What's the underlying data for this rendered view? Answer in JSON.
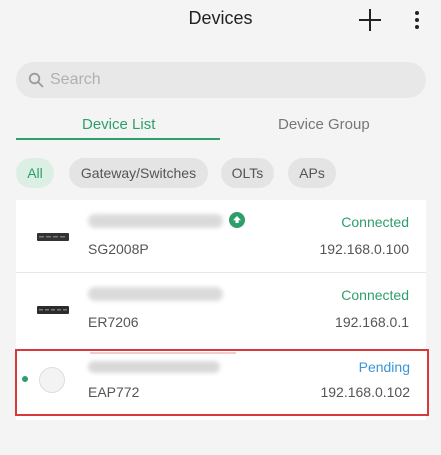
{
  "header": {
    "title": "Devices"
  },
  "search": {
    "placeholder": "Search"
  },
  "tabs": [
    {
      "label": "Device List",
      "active": true
    },
    {
      "label": "Device Group",
      "active": false
    }
  ],
  "filters": [
    {
      "label": "All",
      "active": true
    },
    {
      "label": "Gateway/Switches",
      "active": false
    },
    {
      "label": "OLTs",
      "active": false
    },
    {
      "label": "APs",
      "active": false
    }
  ],
  "devices": [
    {
      "model": "SG2008P",
      "status": "Connected",
      "ip": "192.168.0.100",
      "status_color": "#2e9e6b",
      "has_upgrade": true,
      "icon": "switch-icon"
    },
    {
      "model": "ER7206",
      "status": "Connected",
      "ip": "192.168.0.1",
      "status_color": "#2e9e6b",
      "has_upgrade": false,
      "icon": "router-icon"
    },
    {
      "model": "EAP772",
      "status": "Pending",
      "ip": "192.168.0.102",
      "status_color": "#3b95d6",
      "has_upgrade": false,
      "icon": "access-point-icon"
    }
  ],
  "colors": {
    "accent": "#2e9e6b",
    "pending": "#3b95d6",
    "selection": "#d63a3a"
  }
}
